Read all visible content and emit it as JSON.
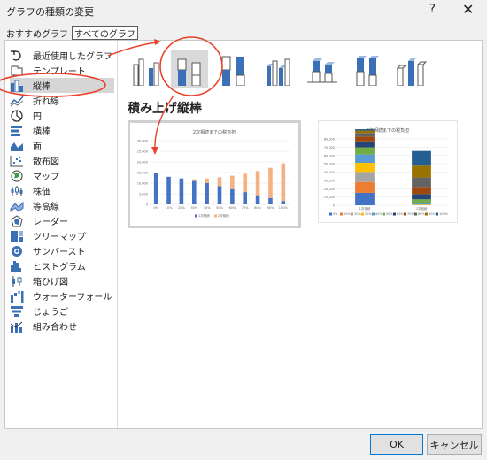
{
  "window": {
    "title": "グラフの種類の変更",
    "help": "?",
    "close": "✕"
  },
  "tabs": [
    {
      "label": "おすすめグラフ"
    },
    {
      "label": "すべてのグラフ"
    }
  ],
  "sidebar": {
    "items": [
      {
        "label": "最近使用したグラフ",
        "icon": "recent-icon"
      },
      {
        "label": "テンプレート",
        "icon": "template-icon"
      },
      {
        "label": "縦棒",
        "icon": "column-chart-icon"
      },
      {
        "label": "折れ線",
        "icon": "line-chart-icon"
      },
      {
        "label": "円",
        "icon": "pie-chart-icon"
      },
      {
        "label": "横棒",
        "icon": "bar-chart-icon"
      },
      {
        "label": "面",
        "icon": "area-chart-icon"
      },
      {
        "label": "散布図",
        "icon": "scatter-chart-icon"
      },
      {
        "label": "マップ",
        "icon": "map-chart-icon"
      },
      {
        "label": "株価",
        "icon": "stock-chart-icon"
      },
      {
        "label": "等高線",
        "icon": "surface-chart-icon"
      },
      {
        "label": "レーダー",
        "icon": "radar-chart-icon"
      },
      {
        "label": "ツリーマップ",
        "icon": "treemap-chart-icon"
      },
      {
        "label": "サンバースト",
        "icon": "sunburst-chart-icon"
      },
      {
        "label": "ヒストグラム",
        "icon": "histogram-chart-icon"
      },
      {
        "label": "箱ひげ図",
        "icon": "boxwhisker-chart-icon"
      },
      {
        "label": "ウォーターフォール",
        "icon": "waterfall-chart-icon"
      },
      {
        "label": "じょうご",
        "icon": "funnel-chart-icon"
      },
      {
        "label": "組み合わせ",
        "icon": "combo-chart-icon"
      }
    ]
  },
  "main": {
    "heading": "積み上げ縦棒"
  },
  "previews": [
    {
      "title": "2次相続までの税負担"
    },
    {
      "title": "2次相続までの税負担"
    }
  ],
  "buttons": {
    "ok": "OK",
    "cancel": "キャンセル"
  },
  "colors": {
    "accent": "#4472c4",
    "orange": "#f4b183",
    "annotation": "#e8412c"
  },
  "chart_data": [
    {
      "type": "bar",
      "title": "2次相続までの税負担",
      "categories": [
        "0%",
        "10%",
        "20%",
        "30%",
        "40%",
        "50%",
        "60%",
        "70%",
        "80%",
        "90%",
        "100%"
      ],
      "ylim": [
        0,
        30000
      ],
      "yticks": [
        "0",
        "5,000",
        "10,000",
        "15,000",
        "20,000",
        "25,000",
        "30,000"
      ],
      "series": [
        {
          "name": "1次相続",
          "color": "#4472c4",
          "values": [
            15000,
            13000,
            12200,
            11000,
            10000,
            8600,
            7200,
            5800,
            4300,
            3000,
            1600
          ]
        },
        {
          "name": "2次相続",
          "color": "#f4b183",
          "values": [
            0,
            0,
            0,
            800,
            2200,
            4200,
            6300,
            8600,
            11400,
            14200,
            17700
          ]
        }
      ]
    },
    {
      "type": "bar",
      "title": "2次相続までの税負担",
      "categories": [
        "1次相続",
        "2次相続"
      ],
      "ylim": [
        0,
        80000
      ],
      "yticks": [
        "0",
        "10,000",
        "20,000",
        "30,000",
        "40,000",
        "50,000",
        "60,000",
        "70,000",
        "80,000"
      ],
      "legend": [
        "0%",
        "10%",
        "20%",
        "30%",
        "40%",
        "50%",
        "60%",
        "70%",
        "80%",
        "90%",
        "100%"
      ],
      "series": [
        {
          "name": "0%",
          "color": "#4472c4",
          "values": [
            15000,
            0
          ]
        },
        {
          "name": "10%",
          "color": "#ed7d31",
          "values": [
            13000,
            0
          ]
        },
        {
          "name": "20%",
          "color": "#a5a5a5",
          "values": [
            12200,
            0
          ]
        },
        {
          "name": "30%",
          "color": "#ffc000",
          "values": [
            11000,
            800
          ]
        },
        {
          "name": "40%",
          "color": "#5b9bd5",
          "values": [
            10000,
            2200
          ]
        },
        {
          "name": "50%",
          "color": "#70ad47",
          "values": [
            8600,
            4200
          ]
        },
        {
          "name": "60%",
          "color": "#264478",
          "values": [
            7200,
            6300
          ]
        },
        {
          "name": "70%",
          "color": "#9e480e",
          "values": [
            5800,
            8600
          ]
        },
        {
          "name": "80%",
          "color": "#636363",
          "values": [
            4300,
            11400
          ]
        },
        {
          "name": "90%",
          "color": "#997300",
          "values": [
            3000,
            14200
          ]
        },
        {
          "name": "100%",
          "color": "#255e91",
          "values": [
            1600,
            17700
          ]
        }
      ]
    }
  ]
}
